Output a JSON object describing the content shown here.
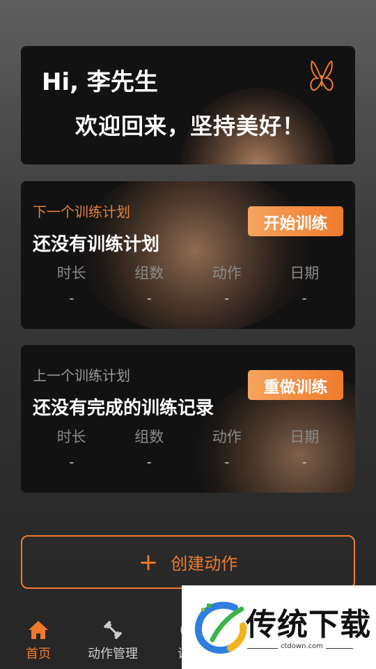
{
  "welcome": {
    "greeting": "Hi, 李先生",
    "motto": "欢迎回来，坚持美好！"
  },
  "next_plan": {
    "kicker": "下一个训练计划",
    "title": "还没有训练计划",
    "button": "开始训练",
    "stats": [
      {
        "label": "时长",
        "value": "-"
      },
      {
        "label": "组数",
        "value": "-"
      },
      {
        "label": "动作",
        "value": "-"
      },
      {
        "label": "日期",
        "value": "-"
      }
    ]
  },
  "prev_plan": {
    "kicker": "上一个训练计划",
    "title": "还没有完成的训练记录",
    "button": "重做训练",
    "stats": [
      {
        "label": "时长",
        "value": "-"
      },
      {
        "label": "组数",
        "value": "-"
      },
      {
        "label": "动作",
        "value": "-"
      },
      {
        "label": "日期",
        "value": "-"
      }
    ]
  },
  "create": {
    "plus": "+",
    "label": "创建动作"
  },
  "tabbar": {
    "tabs": [
      {
        "label": "首页",
        "icon": "home-icon",
        "active": true
      },
      {
        "label": "动作管理",
        "icon": "dumbbell-icon",
        "active": false
      },
      {
        "label": "训练",
        "icon": "training-icon",
        "active": false
      }
    ]
  },
  "watermark": {
    "text": "传统下载",
    "domain": "ctdown.com"
  },
  "colors": {
    "accent": "#f07a2c",
    "card": "#121212"
  }
}
